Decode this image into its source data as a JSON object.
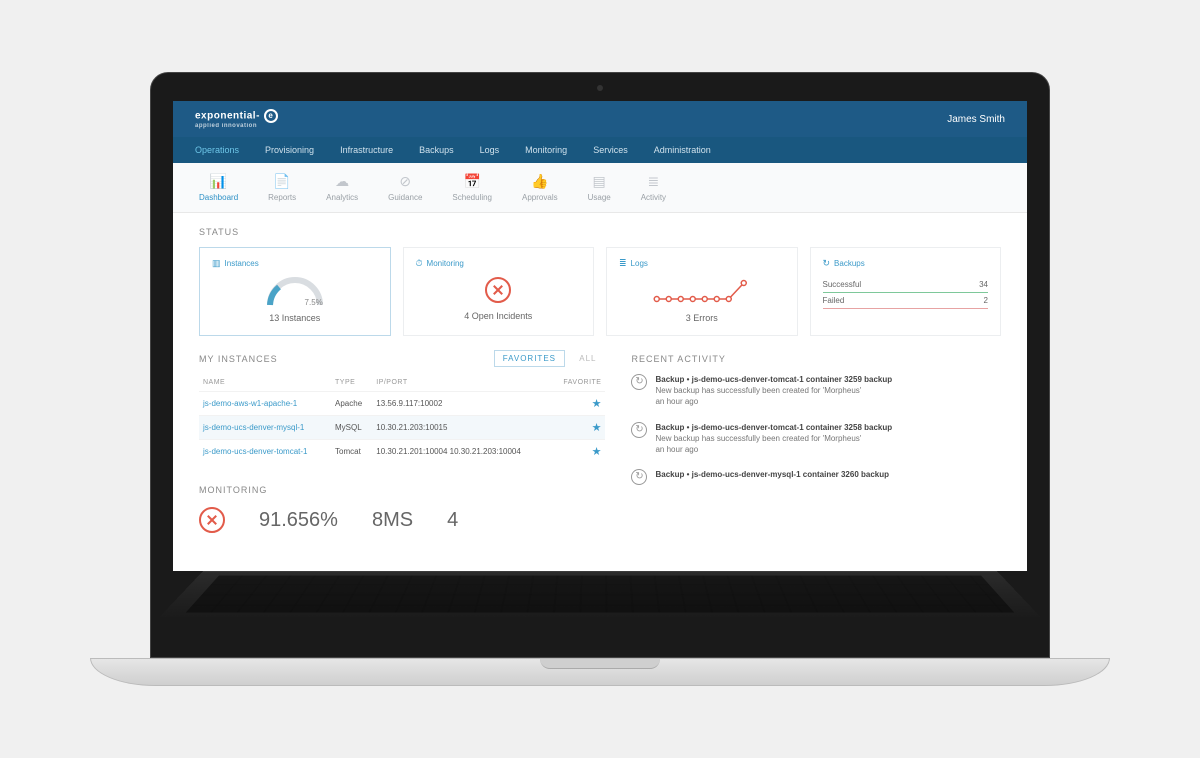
{
  "brand": {
    "name": "exponential-",
    "mark": "e",
    "tagline": "applied innovation"
  },
  "user": {
    "name": "James Smith"
  },
  "mainnav": [
    {
      "label": "Operations",
      "active": true
    },
    {
      "label": "Provisioning"
    },
    {
      "label": "Infrastructure"
    },
    {
      "label": "Backups"
    },
    {
      "label": "Logs"
    },
    {
      "label": "Monitoring"
    },
    {
      "label": "Services"
    },
    {
      "label": "Administration"
    }
  ],
  "subnav": [
    {
      "label": "Dashboard",
      "icon": "📊",
      "active": true
    },
    {
      "label": "Reports",
      "icon": "📄"
    },
    {
      "label": "Analytics",
      "icon": "☁"
    },
    {
      "label": "Guidance",
      "icon": "⊘"
    },
    {
      "label": "Scheduling",
      "icon": "📅"
    },
    {
      "label": "Approvals",
      "icon": "👍"
    },
    {
      "label": "Usage",
      "icon": "▤"
    },
    {
      "label": "Activity",
      "icon": "≣"
    }
  ],
  "status": {
    "heading": "STATUS",
    "cards": {
      "instances": {
        "title": "Instances",
        "percent": "7.5%",
        "summary": "13 Instances"
      },
      "monitoring": {
        "title": "Monitoring",
        "summary": "4 Open Incidents"
      },
      "logs": {
        "title": "Logs",
        "summary": "3 Errors"
      },
      "backups": {
        "title": "Backups",
        "rows": [
          {
            "label": "Successful",
            "value": "34"
          },
          {
            "label": "Failed",
            "value": "2"
          }
        ]
      }
    }
  },
  "instances": {
    "heading": "MY INSTANCES",
    "tabs": {
      "favorites": "FAVORITES",
      "all": "ALL"
    },
    "columns": {
      "name": "NAME",
      "type": "TYPE",
      "ipport": "IP/PORT",
      "favorite": "FAVORITE"
    },
    "rows": [
      {
        "name": "js-demo-aws-w1-apache-1",
        "type": "Apache",
        "ipport": "13.56.9.117:10002",
        "fav": true
      },
      {
        "name": "js-demo-ucs-denver-mysql-1",
        "type": "MySQL",
        "ipport": "10.30.21.203:10015",
        "fav": true,
        "highlight": true
      },
      {
        "name": "js-demo-ucs-denver-tomcat-1",
        "type": "Tomcat",
        "ipport": "10.30.21.201:10004 10.30.21.203:10004",
        "fav": true
      }
    ]
  },
  "monitoring": {
    "heading": "MONITORING",
    "availability": "91.656%",
    "response": "8MS",
    "incidents": "4"
  },
  "activity": {
    "heading": "RECENT ACTIVITY",
    "items": [
      {
        "title_prefix": "Backup • js-demo-ucs-denver-tomcat-1 container ",
        "title_bold": "3259",
        "title_suffix": " backup",
        "body": "New backup has successfully been created for 'Morpheus'",
        "time": "an hour ago"
      },
      {
        "title_prefix": "Backup • js-demo-ucs-denver-tomcat-1 container ",
        "title_bold": "3258",
        "title_suffix": " backup",
        "body": "New backup has successfully been created for 'Morpheus'",
        "time": "an hour ago"
      },
      {
        "title_prefix": "Backup • js-demo-ucs-denver-mysql-1 container ",
        "title_bold": "3260",
        "title_suffix": " backup",
        "body": "",
        "time": ""
      }
    ]
  }
}
